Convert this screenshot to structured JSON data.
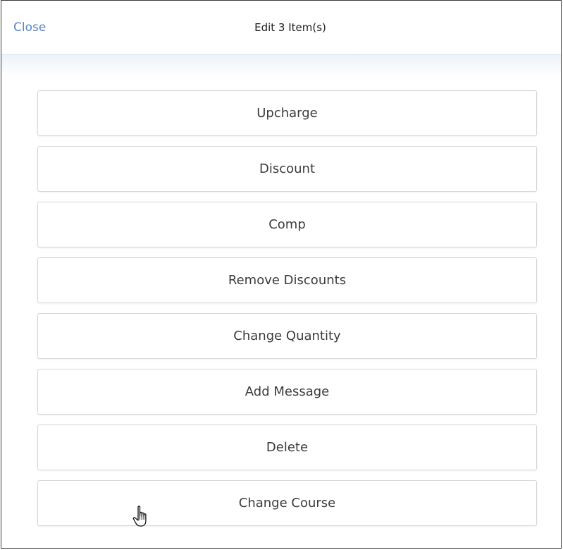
{
  "header": {
    "close_label": "Close",
    "title": "Edit 3 Item(s)"
  },
  "actions": [
    {
      "label": "Upcharge"
    },
    {
      "label": "Discount"
    },
    {
      "label": "Comp"
    },
    {
      "label": "Remove Discounts"
    },
    {
      "label": "Change Quantity"
    },
    {
      "label": "Add Message"
    },
    {
      "label": "Delete"
    },
    {
      "label": "Change Course"
    }
  ],
  "colors": {
    "accent": "#5a86c3",
    "text": "#3b3b3b",
    "border": "#d6d6d6"
  },
  "icons": {
    "cursor": "hand-pointer-icon"
  }
}
